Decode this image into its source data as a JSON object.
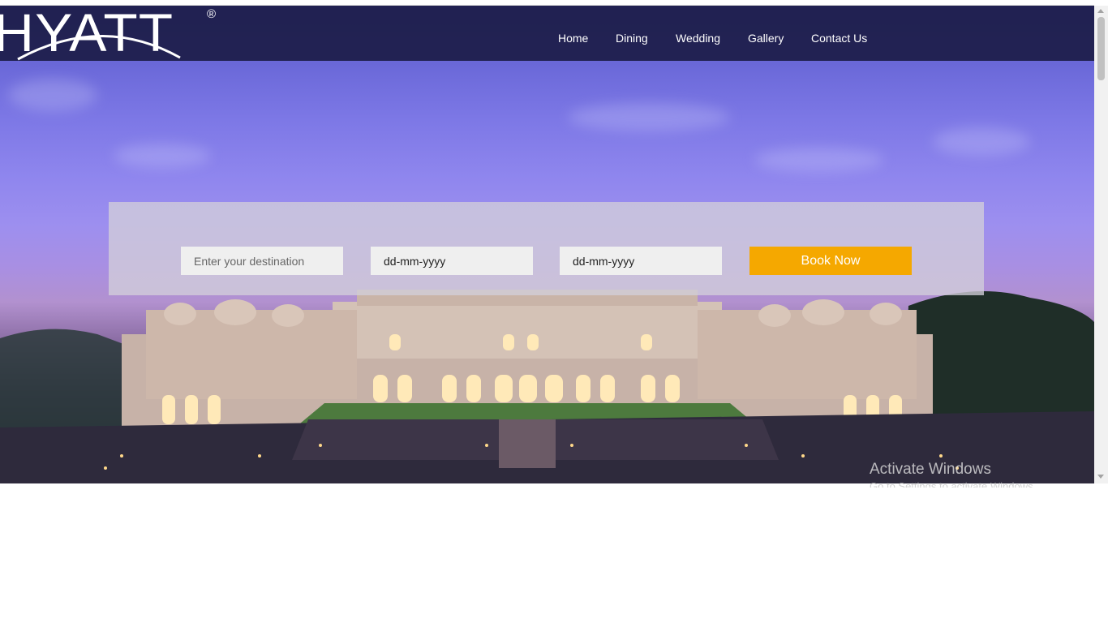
{
  "brand": {
    "logo_text": "HYATT",
    "registered_mark": "®"
  },
  "nav": {
    "items": [
      {
        "label": "Home"
      },
      {
        "label": "Dining"
      },
      {
        "label": "Wedding"
      },
      {
        "label": "Gallery"
      },
      {
        "label": "Contact Us"
      }
    ]
  },
  "booking": {
    "destination_placeholder": "Enter your destination",
    "checkin_value": "dd-mm-yyyy",
    "checkout_value": "dd-mm-yyyy",
    "book_button_label": "Book Now"
  },
  "watermark": {
    "title": "Activate Windows",
    "subtitle": "Go to Settings to activate Windows."
  },
  "colors": {
    "nav_background": "#1c1c48",
    "book_button": "#f5a800",
    "panel_background": "#d2ceda"
  }
}
